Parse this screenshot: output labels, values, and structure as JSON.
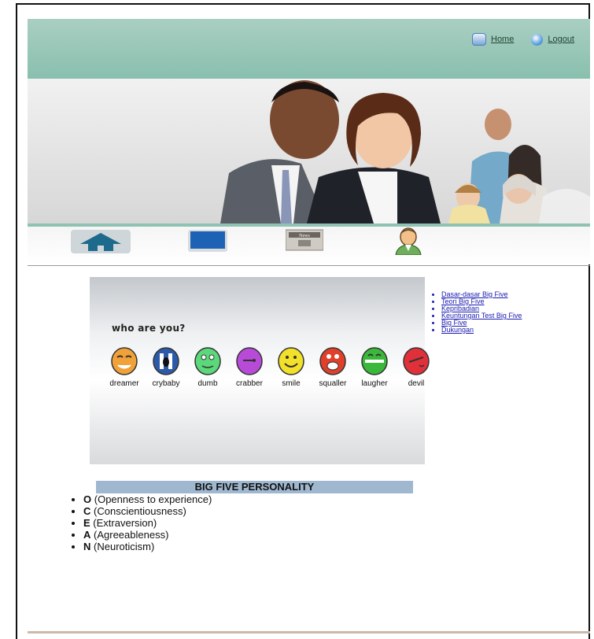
{
  "header": {
    "links": [
      {
        "label": "Home",
        "icon": "home-icon"
      },
      {
        "label": "Logout",
        "icon": "logout-icon"
      }
    ],
    "colors": {
      "header_bg": "#89bfae",
      "accent_line": "#8fc2b2"
    }
  },
  "icon_nav": [
    "home-icon",
    "monitor-icon",
    "news-icon",
    "user-icon"
  ],
  "news_icon_text": "News",
  "banner": {
    "title": "who are you?",
    "faces": [
      {
        "label": "dreamer",
        "color": "#f0a13a"
      },
      {
        "label": "crybaby",
        "color": "#2a5aa8"
      },
      {
        "label": "dumb",
        "color": "#5ad87a"
      },
      {
        "label": "crabber",
        "color": "#b84ad8"
      },
      {
        "label": "smile",
        "color": "#f2e02a"
      },
      {
        "label": "squaller",
        "color": "#e0402a"
      },
      {
        "label": "laugher",
        "color": "#3ab83a"
      },
      {
        "label": "devil",
        "color": "#e0303a"
      }
    ]
  },
  "side_links": [
    "Dasar-dasar Big Five",
    "Teori Big Five",
    "Kepribadian",
    "Keuntungan Test Big Five",
    "Big Five",
    "Dukungan"
  ],
  "big_five": {
    "heading": "BIG FIVE PERSONALITY",
    "traits": [
      {
        "letter": "O",
        "desc": "(Openness to experience)"
      },
      {
        "letter": "C",
        "desc": "(Conscientiousness)"
      },
      {
        "letter": "E",
        "desc": "(Extraversion)"
      },
      {
        "letter": "A",
        "desc": "(Agreeableness)"
      },
      {
        "letter": "N",
        "desc": "(Neuroticism)"
      }
    ]
  }
}
